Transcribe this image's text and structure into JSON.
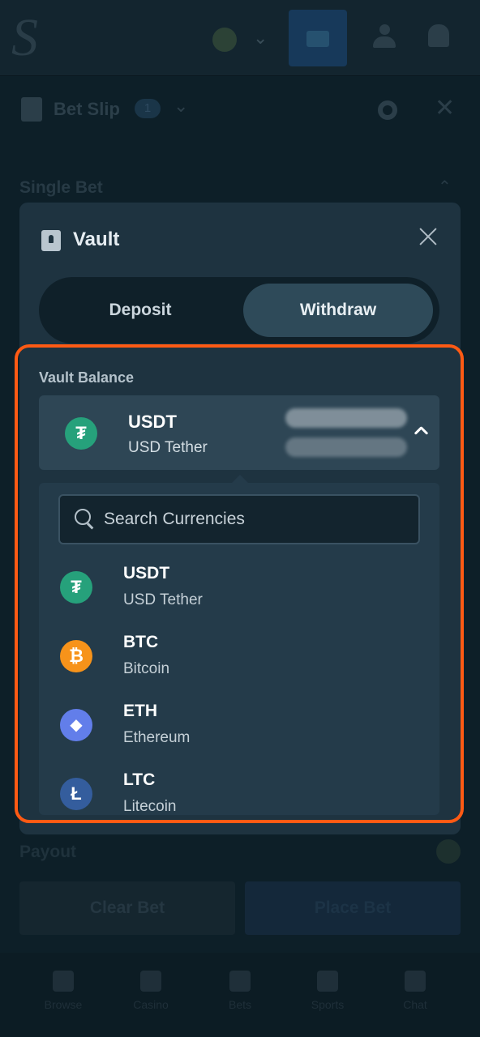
{
  "topbar": {
    "logo": "S",
    "icons": [
      "coin-icon",
      "chevron-down-icon",
      "wallet-icon",
      "user-icon",
      "bell-icon"
    ]
  },
  "betslip": {
    "title": "Bet Slip",
    "count": "1",
    "section": "Single Bet",
    "payout_label": "Payout",
    "clear_label": "Clear Bet",
    "place_label": "Place Bet"
  },
  "bottom_nav": {
    "items": [
      {
        "label": "Browse",
        "icon": "browse-icon"
      },
      {
        "label": "Casino",
        "icon": "casino-icon"
      },
      {
        "label": "Bets",
        "icon": "bets-icon"
      },
      {
        "label": "Sports",
        "icon": "sports-icon"
      },
      {
        "label": "Chat",
        "icon": "chat-icon"
      }
    ]
  },
  "vault": {
    "title": "Vault",
    "tabs": [
      {
        "label": "Deposit",
        "active": false
      },
      {
        "label": "Withdraw",
        "active": true
      }
    ],
    "balance_label": "Vault Balance",
    "selected": {
      "code": "USDT",
      "name": "USD Tether",
      "symbol": "₮",
      "color": "#26a17b"
    },
    "search_placeholder": "Search Currencies",
    "currencies": [
      {
        "code": "USDT",
        "name": "USD Tether",
        "symbol": "₮",
        "color": "#26a17b"
      },
      {
        "code": "BTC",
        "name": "Bitcoin",
        "symbol": "₿",
        "color": "#f7931a"
      },
      {
        "code": "ETH",
        "name": "Ethereum",
        "symbol": "◆",
        "color": "#627eea"
      },
      {
        "code": "LTC",
        "name": "Litecoin",
        "symbol": "Ł",
        "color": "#345d9d"
      }
    ]
  },
  "colors": {
    "accent_highlight": "#ff5a14",
    "modal_bg": "#1e3340",
    "active_tab": "#2e4a59"
  }
}
